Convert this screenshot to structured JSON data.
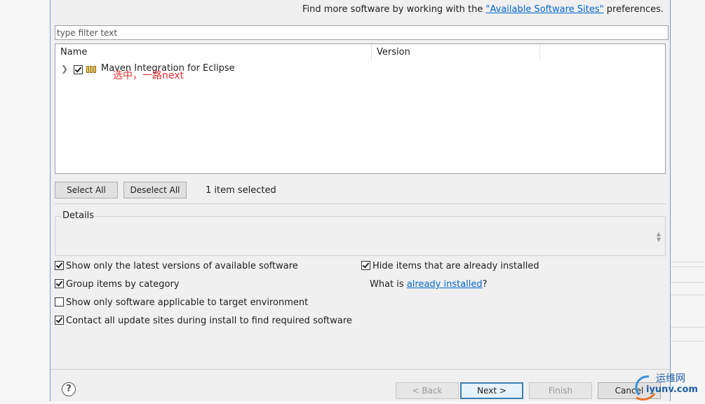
{
  "hint": {
    "prefix": "Find more software by working with the ",
    "link": "\"Available Software Sites\"",
    "suffix": " preferences."
  },
  "filter": {
    "placeholder": "type filter text",
    "value": ""
  },
  "table": {
    "columns": [
      "Name",
      "Version"
    ],
    "rows": [
      {
        "name": "Maven Integration for Eclipse",
        "version": "",
        "checked": true,
        "expandable": true
      }
    ]
  },
  "annotation": "选中，一路next",
  "buttons": {
    "select_all": "Select All",
    "deselect_all": "Deselect All"
  },
  "selection_status": "1 item selected",
  "details_label": "Details",
  "options": {
    "latest_versions": {
      "label": "Show only the latest versions of available software",
      "checked": true
    },
    "group_by_category": {
      "label": "Group items by category",
      "checked": true
    },
    "target_env": {
      "label": "Show only software applicable to target environment",
      "checked": false
    },
    "contact_sites": {
      "label": "Contact all update sites during install to find required software",
      "checked": true
    },
    "hide_installed": {
      "label": "Hide items that are already installed",
      "checked": true
    }
  },
  "what_is": {
    "prefix": "What is ",
    "link": "already installed",
    "suffix": "?"
  },
  "footer": {
    "help": "?",
    "back": "< Back",
    "next": "Next >",
    "finish": "Finish",
    "cancel": "Cancel"
  },
  "watermark": {
    "line1": "运维网",
    "line2": "iyunv.com"
  },
  "colors": {
    "link": "#0066cc",
    "annotation": "#e03030",
    "default_button_border": "#3c7fb1"
  }
}
